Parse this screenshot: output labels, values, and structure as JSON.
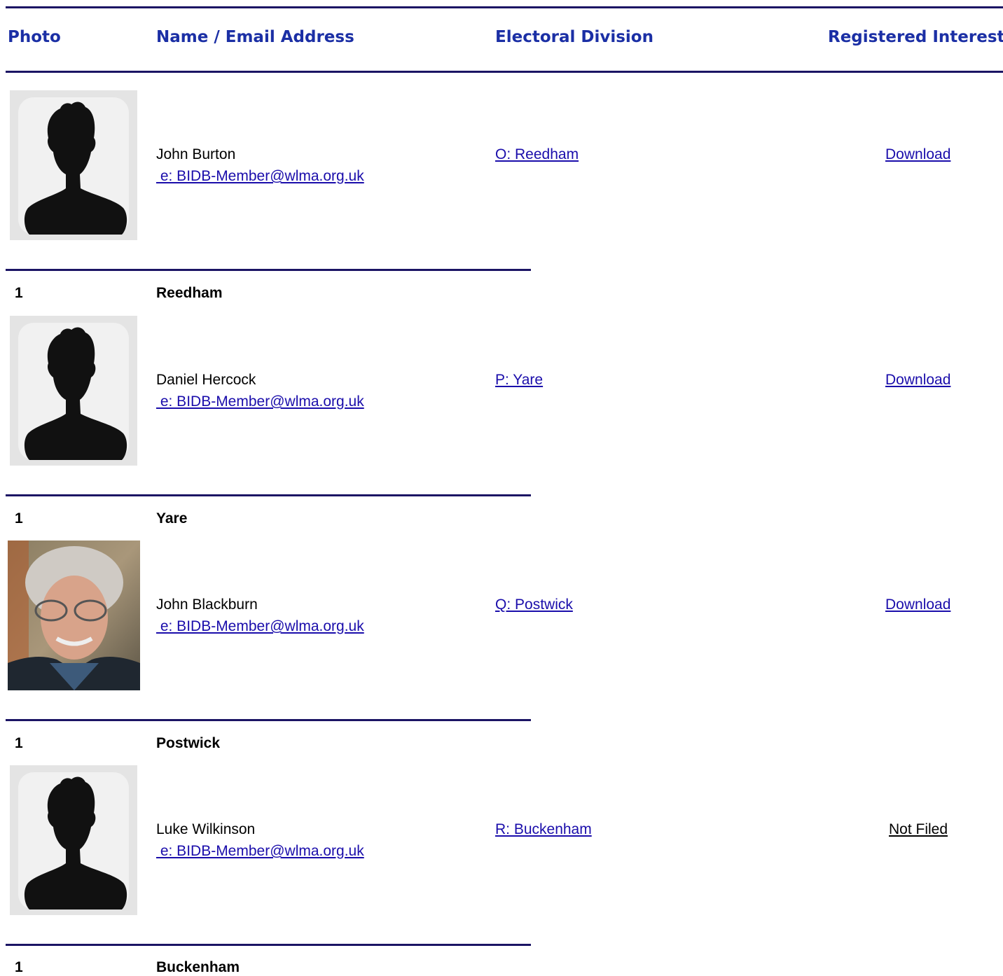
{
  "header": {
    "photo": "Photo",
    "name_email": "Name / Email Address",
    "division": "Electoral Division",
    "interests": "Registered Interests"
  },
  "members": [
    {
      "name": "John Burton",
      "email": " e: BIDB-Member@wlma.org.uk",
      "division": "O: Reedham",
      "interests": "Download",
      "photo_icon": "silhouette-avatar-icon"
    },
    {
      "name": "Daniel Hercock",
      "email": " e: BIDB-Member@wlma.org.uk",
      "division": "P: Yare",
      "interests": "Download",
      "photo_icon": "silhouette-avatar-icon"
    },
    {
      "name": "John Blackburn",
      "email": " e: BIDB-Member@wlma.org.uk",
      "division": "Q: Postwick",
      "interests": "Download",
      "photo_icon": "portrait-photo"
    },
    {
      "name": "Luke Wilkinson",
      "email": " e: BIDB-Member@wlma.org.uk",
      "division": "R: Buckenham",
      "interests": "Not Filed",
      "photo_icon": "silhouette-avatar-icon"
    }
  ],
  "groups": [
    {
      "number": "1",
      "name": "Reedham"
    },
    {
      "number": "1",
      "name": "Yare"
    },
    {
      "number": "1",
      "name": "Postwick"
    },
    {
      "number": "1",
      "name": "Buckenham"
    }
  ],
  "colors": {
    "rule": "#1b1464",
    "header_text": "#1b2fa5",
    "link": "#1a0dab"
  }
}
